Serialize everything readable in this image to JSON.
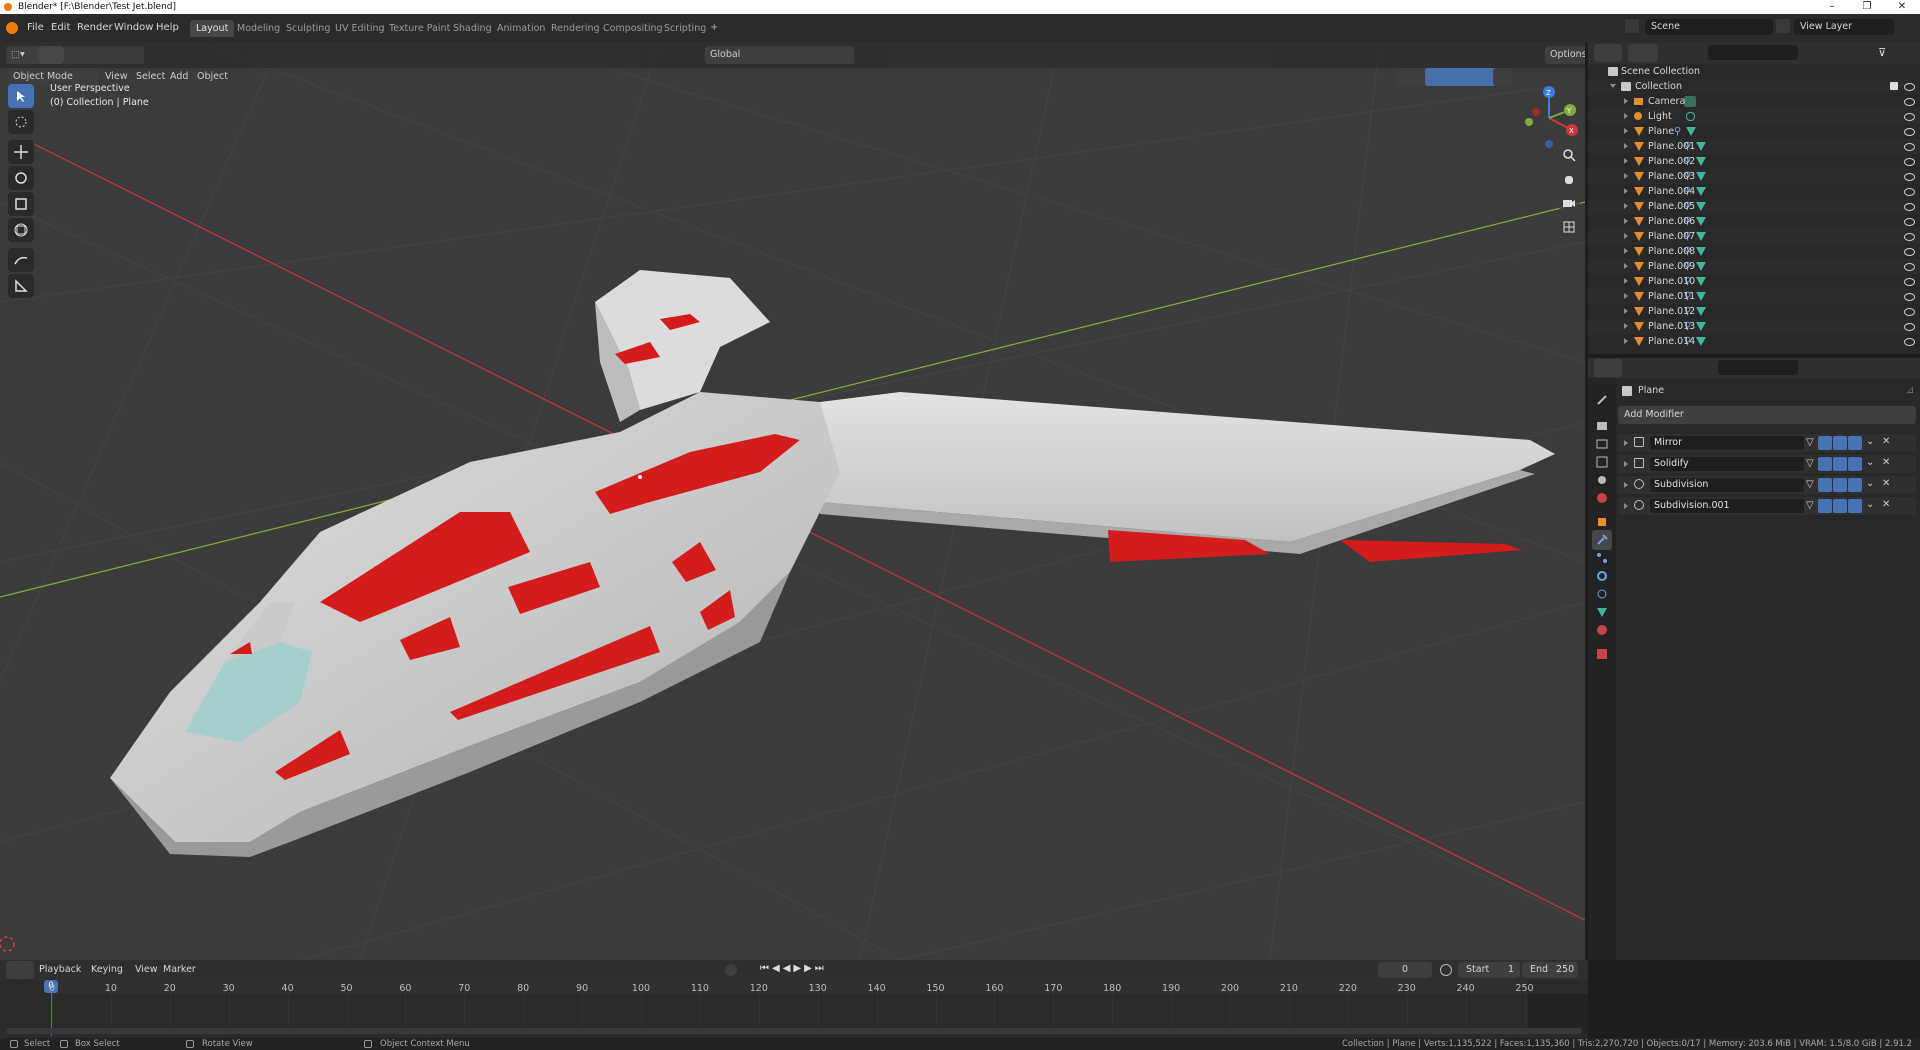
{
  "window": {
    "title": "Blender* [F:\\Blender\\Test Jet.blend]",
    "minimize": "–",
    "maximize": "❐",
    "close": "✕"
  },
  "menubar": {
    "items": [
      "File",
      "Edit",
      "Render",
      "Window",
      "Help"
    ]
  },
  "workspaces": {
    "tabs": [
      "Layout",
      "Modeling",
      "Sculpting",
      "UV Editing",
      "Texture Paint",
      "Shading",
      "Animation",
      "Rendering",
      "Compositing",
      "Scripting"
    ],
    "active": "Layout",
    "add": "+"
  },
  "scene": {
    "name": "Scene",
    "view_layer": "View Layer"
  },
  "viewport_header": {
    "mode": "Object Mode",
    "menus": [
      "View",
      "Select",
      "Add",
      "Object"
    ],
    "orientation": "Global",
    "options": "Options"
  },
  "viewport": {
    "perspective": "User Perspective",
    "context": "(0) Collection | Plane"
  },
  "gizmo": {
    "x": "X",
    "y": "Y",
    "z": "Z"
  },
  "outliner": {
    "root": "Scene Collection",
    "collection": "Collection",
    "items": [
      "Camera",
      "Light",
      "Plane",
      "Plane.001",
      "Plane.002",
      "Plane.003",
      "Plane.004",
      "Plane.005",
      "Plane.006",
      "Plane.007",
      "Plane.008",
      "Plane.009",
      "Plane.010",
      "Plane.011",
      "Plane.012",
      "Plane.013",
      "Plane.014"
    ]
  },
  "properties": {
    "object_name": "Plane",
    "add_modifier": "Add Modifier",
    "modifiers": [
      "Mirror",
      "Solidify",
      "Subdivision",
      "Subdivision.001"
    ]
  },
  "timeline": {
    "menus": [
      "Playback",
      "Keying",
      "View",
      "Marker"
    ],
    "current_frame": "0",
    "start_label": "Start",
    "start": "1",
    "end_label": "End",
    "end": "250",
    "ticks": [
      "0",
      "10",
      "20",
      "30",
      "40",
      "50",
      "60",
      "70",
      "80",
      "90",
      "100",
      "110",
      "120",
      "130",
      "140",
      "150",
      "160",
      "170",
      "180",
      "190",
      "200",
      "210",
      "220",
      "230",
      "240",
      "250"
    ],
    "frame_badge": "0"
  },
  "statusbar": {
    "select": "Select",
    "box_select": "Box Select",
    "rotate": "Rotate View",
    "context_menu": "Object Context Menu",
    "stats": "Collection | Plane | Verts:1,135,522 | Faces:1,135,360 | Tris:2,270,720 | Objects:0/17 | Memory: 203.6 MiB | VRAM: 1.5/8.0 GiB | 2.91.2"
  },
  "colors": {
    "accent": "#4772b3",
    "x_axis": "#c93a3a",
    "y_axis": "#7fae3a",
    "jet_body": "#d7d7d7",
    "jet_red": "#d51c1c",
    "canopy": "#9ecfcc"
  }
}
